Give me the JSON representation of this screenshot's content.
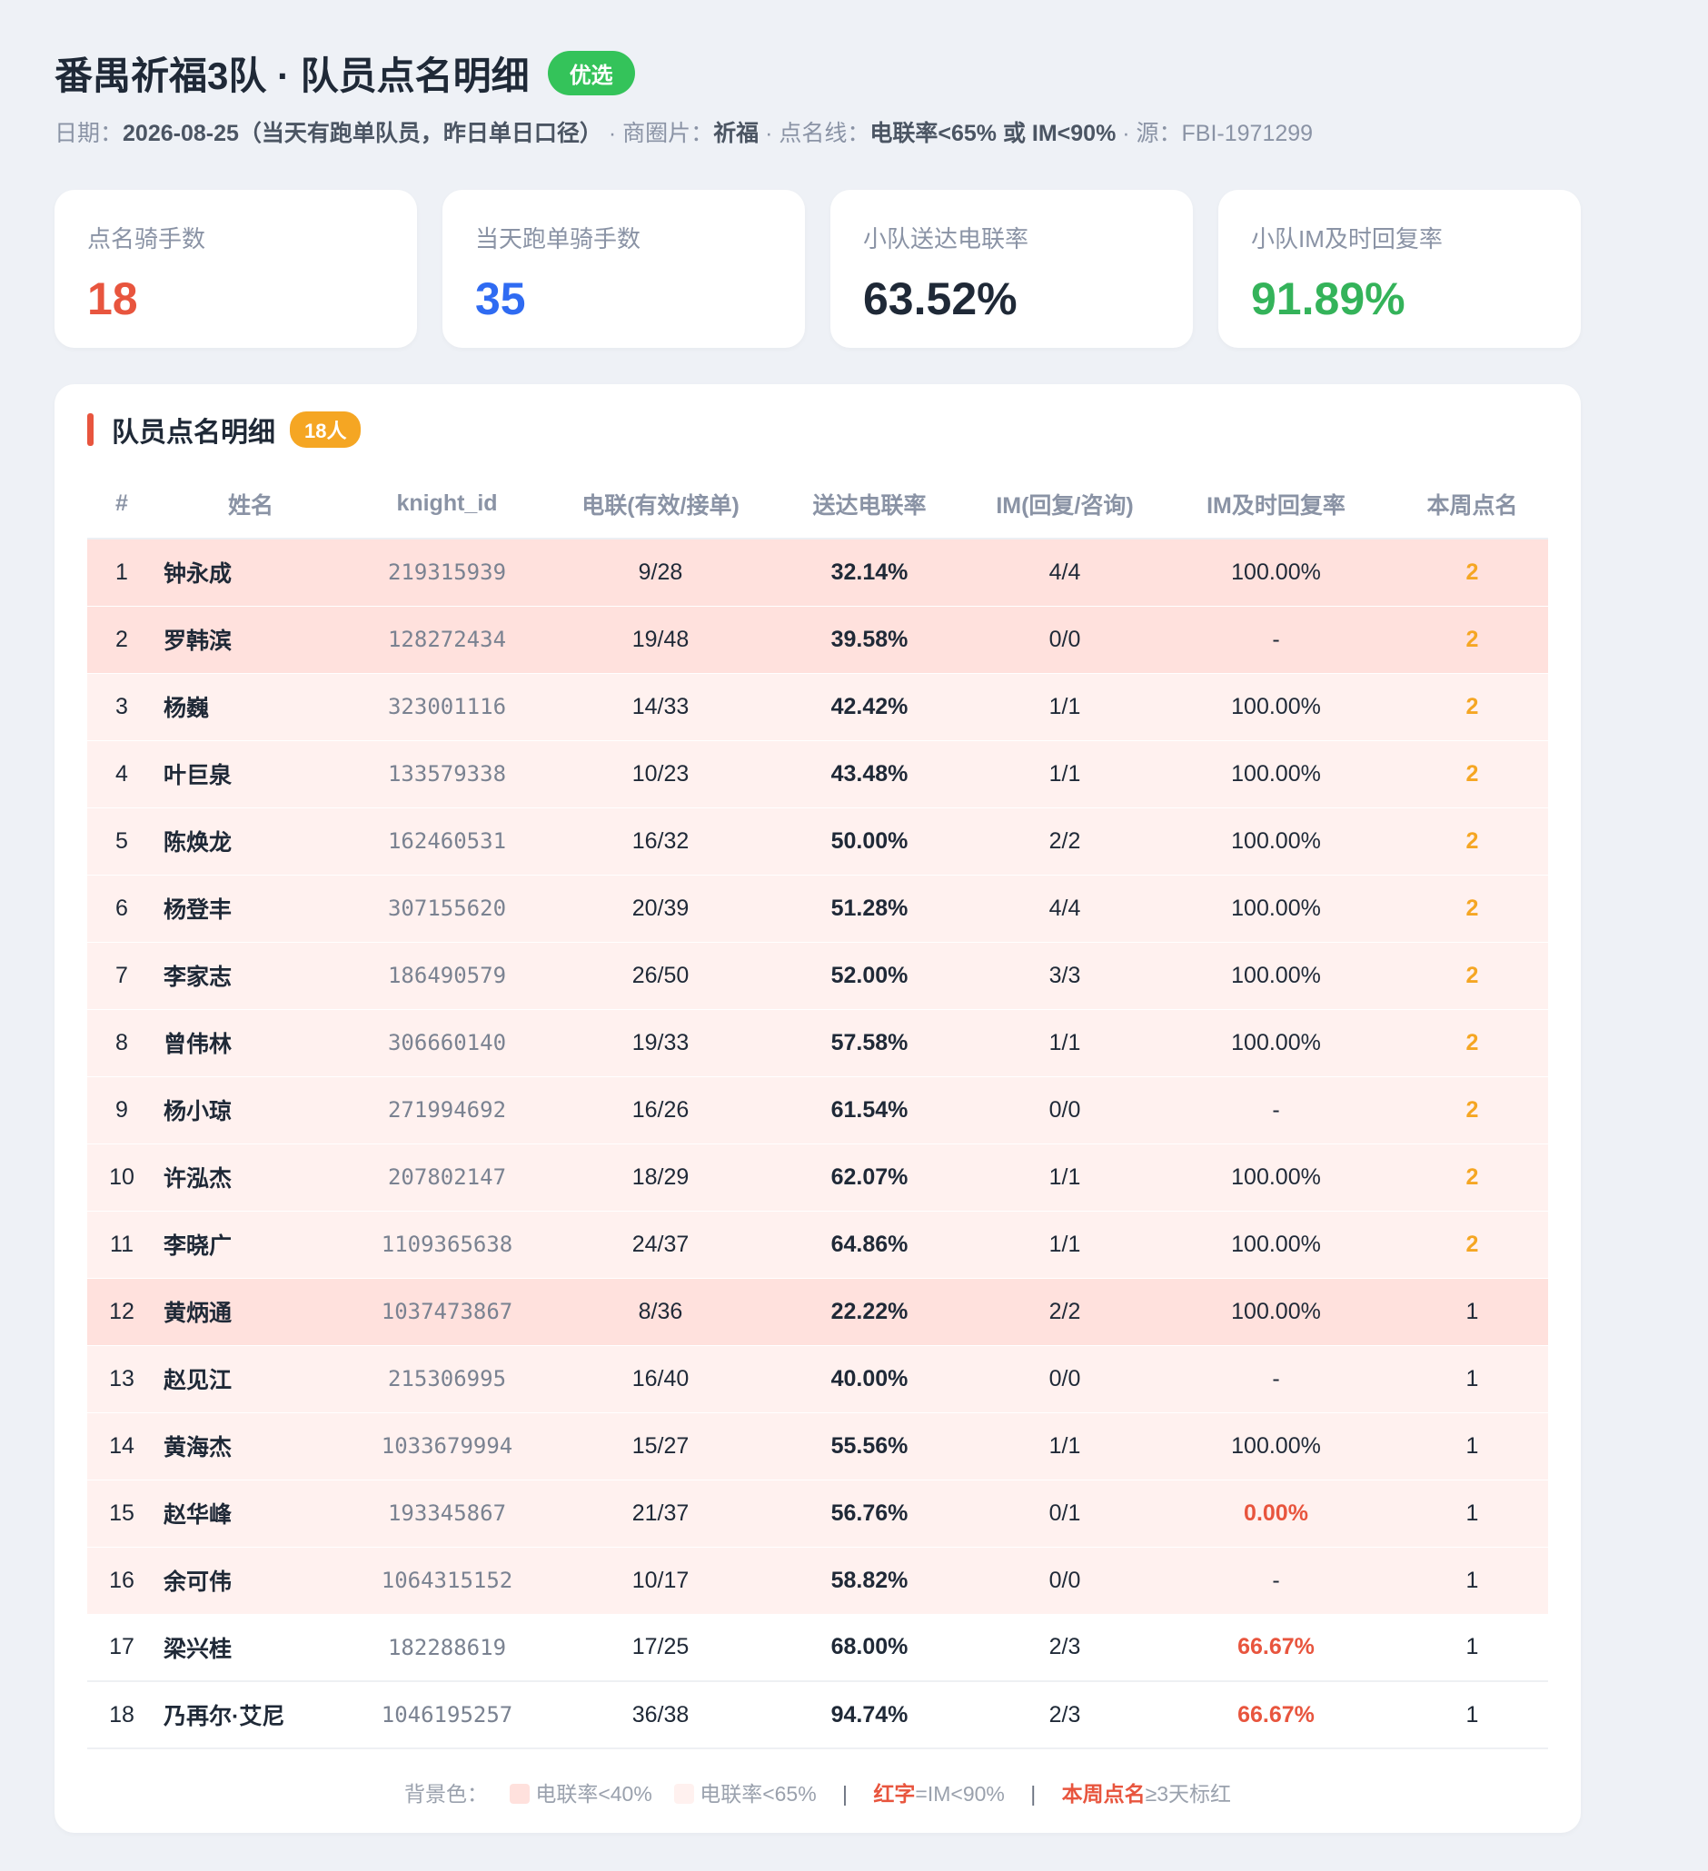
{
  "header": {
    "title": "番禺祈福3队 · 队员点名明细",
    "tag": "优选",
    "date_label": "日期：",
    "date_value": "2026-08-25（当天有跑单队员，昨日单日口径）",
    "area_label": " · 商圈片：",
    "area_value": "祈福",
    "line_label": " · 点名线：",
    "line_value": "电联率<65% 或 IM<90%",
    "source_label": " · 源：FBI-1971299"
  },
  "stats": [
    {
      "label": "点名骑手数",
      "value": "18",
      "color": "#e8553e"
    },
    {
      "label": "当天跑单骑手数",
      "value": "35",
      "color": "#2f6bf2"
    },
    {
      "label": "小队送达电联率",
      "value": "63.52%",
      "color": "#1f2937"
    },
    {
      "label": "小队IM及时回复率",
      "value": "91.89%",
      "color": "#34b35a"
    }
  ],
  "section": {
    "title": "队员点名明细",
    "count_badge": "18人"
  },
  "table": {
    "headers": [
      "#",
      "姓名",
      "knight_id",
      "电联(有效/接单)",
      "送达电联率",
      "IM(回复/咨询)",
      "IM及时回复率",
      "本周点名"
    ],
    "rows": [
      {
        "no": "1",
        "name": "钟永成",
        "kid": "219315939",
        "call": "9/28",
        "rate": "32.14%",
        "im": "4/4",
        "im_rate": "100.00%",
        "week": "2",
        "bg": "dark",
        "im_red": false,
        "week_orange": true
      },
      {
        "no": "2",
        "name": "罗韩滨",
        "kid": "128272434",
        "call": "19/48",
        "rate": "39.58%",
        "im": "0/0",
        "im_rate": "-",
        "week": "2",
        "bg": "dark",
        "im_red": false,
        "week_orange": true
      },
      {
        "no": "3",
        "name": "杨巍",
        "kid": "323001116",
        "call": "14/33",
        "rate": "42.42%",
        "im": "1/1",
        "im_rate": "100.00%",
        "week": "2",
        "bg": "light",
        "im_red": false,
        "week_orange": true
      },
      {
        "no": "4",
        "name": "叶巨泉",
        "kid": "133579338",
        "call": "10/23",
        "rate": "43.48%",
        "im": "1/1",
        "im_rate": "100.00%",
        "week": "2",
        "bg": "light",
        "im_red": false,
        "week_orange": true
      },
      {
        "no": "5",
        "name": "陈焕龙",
        "kid": "162460531",
        "call": "16/32",
        "rate": "50.00%",
        "im": "2/2",
        "im_rate": "100.00%",
        "week": "2",
        "bg": "light",
        "im_red": false,
        "week_orange": true
      },
      {
        "no": "6",
        "name": "杨登丰",
        "kid": "307155620",
        "call": "20/39",
        "rate": "51.28%",
        "im": "4/4",
        "im_rate": "100.00%",
        "week": "2",
        "bg": "light",
        "im_red": false,
        "week_orange": true
      },
      {
        "no": "7",
        "name": "李家志",
        "kid": "186490579",
        "call": "26/50",
        "rate": "52.00%",
        "im": "3/3",
        "im_rate": "100.00%",
        "week": "2",
        "bg": "light",
        "im_red": false,
        "week_orange": true
      },
      {
        "no": "8",
        "name": "曾伟林",
        "kid": "306660140",
        "call": "19/33",
        "rate": "57.58%",
        "im": "1/1",
        "im_rate": "100.00%",
        "week": "2",
        "bg": "light",
        "im_red": false,
        "week_orange": true
      },
      {
        "no": "9",
        "name": "杨小琼",
        "kid": "271994692",
        "call": "16/26",
        "rate": "61.54%",
        "im": "0/0",
        "im_rate": "-",
        "week": "2",
        "bg": "light",
        "im_red": false,
        "week_orange": true
      },
      {
        "no": "10",
        "name": "许泓杰",
        "kid": "207802147",
        "call": "18/29",
        "rate": "62.07%",
        "im": "1/1",
        "im_rate": "100.00%",
        "week": "2",
        "bg": "light",
        "im_red": false,
        "week_orange": true
      },
      {
        "no": "11",
        "name": "李晓广",
        "kid": "1109365638",
        "call": "24/37",
        "rate": "64.86%",
        "im": "1/1",
        "im_rate": "100.00%",
        "week": "2",
        "bg": "light",
        "im_red": false,
        "week_orange": true
      },
      {
        "no": "12",
        "name": "黄炳通",
        "kid": "1037473867",
        "call": "8/36",
        "rate": "22.22%",
        "im": "2/2",
        "im_rate": "100.00%",
        "week": "1",
        "bg": "dark",
        "im_red": false,
        "week_orange": false
      },
      {
        "no": "13",
        "name": "赵见江",
        "kid": "215306995",
        "call": "16/40",
        "rate": "40.00%",
        "im": "0/0",
        "im_rate": "-",
        "week": "1",
        "bg": "light",
        "im_red": false,
        "week_orange": false
      },
      {
        "no": "14",
        "name": "黄海杰",
        "kid": "1033679994",
        "call": "15/27",
        "rate": "55.56%",
        "im": "1/1",
        "im_rate": "100.00%",
        "week": "1",
        "bg": "light",
        "im_red": false,
        "week_orange": false
      },
      {
        "no": "15",
        "name": "赵华峰",
        "kid": "193345867",
        "call": "21/37",
        "rate": "56.76%",
        "im": "0/1",
        "im_rate": "0.00%",
        "week": "1",
        "bg": "light",
        "im_red": true,
        "week_orange": false
      },
      {
        "no": "16",
        "name": "余可伟",
        "kid": "1064315152",
        "call": "10/17",
        "rate": "58.82%",
        "im": "0/0",
        "im_rate": "-",
        "week": "1",
        "bg": "light",
        "im_red": false,
        "week_orange": false
      },
      {
        "no": "17",
        "name": "梁兴桂",
        "kid": "182288619",
        "call": "17/25",
        "rate": "68.00%",
        "im": "2/3",
        "im_rate": "66.67%",
        "week": "1",
        "bg": "plain",
        "im_red": true,
        "week_orange": false
      },
      {
        "no": "18",
        "name": "乃再尔·艾尼",
        "kid": "1046195257",
        "call": "36/38",
        "rate": "94.74%",
        "im": "2/3",
        "im_rate": "66.67%",
        "week": "1",
        "bg": "plain",
        "im_red": true,
        "week_orange": false
      }
    ]
  },
  "legend": {
    "prefix": "背景色：",
    "item1": "电联率<40%",
    "item1_color": "#ffe1dd",
    "item2": "电联率<65%",
    "item2_color": "#fff1ef",
    "sep": "|",
    "red_word": "红字",
    "red_rest": "=IM<90%",
    "week_word": "本周点名",
    "week_rest": "≥3天标红"
  }
}
